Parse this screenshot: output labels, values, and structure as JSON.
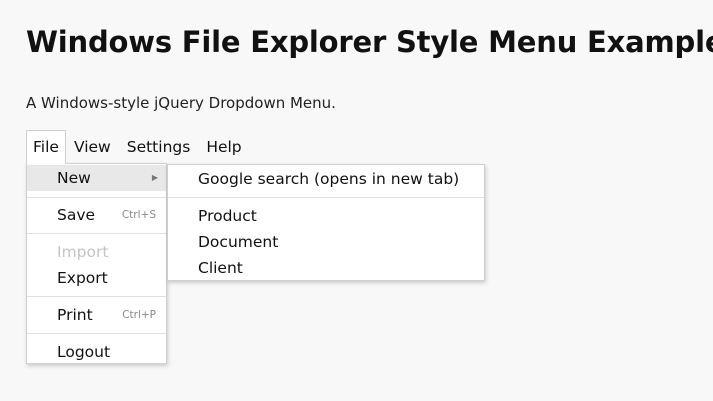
{
  "page": {
    "title": "Windows File Explorer Style Menu Example",
    "subtitle": "A Windows-style jQuery Dropdown Menu."
  },
  "menubar": {
    "items": [
      {
        "label": "File"
      },
      {
        "label": "View"
      },
      {
        "label": "Settings"
      },
      {
        "label": "Help"
      }
    ],
    "active": "File"
  },
  "file_menu": {
    "new": {
      "label": "New",
      "icon": "submenu-arrow-icon"
    },
    "save": {
      "label": "Save",
      "shortcut": "Ctrl+S"
    },
    "import": {
      "label": "Import",
      "disabled": true
    },
    "export": {
      "label": "Export"
    },
    "print": {
      "label": "Print",
      "shortcut": "Ctrl+P"
    },
    "logout": {
      "label": "Logout"
    }
  },
  "new_submenu": {
    "items": [
      {
        "label": "Google search (opens in new tab)"
      },
      {
        "label": "Product"
      },
      {
        "label": "Document"
      },
      {
        "label": "Client"
      }
    ]
  },
  "colors": {
    "background": "#f8f8f8",
    "menu_background": "#ffffff",
    "hover": "#e8e8e8",
    "disabled_text": "#c4c4c4",
    "border": "#cfcfcf"
  }
}
